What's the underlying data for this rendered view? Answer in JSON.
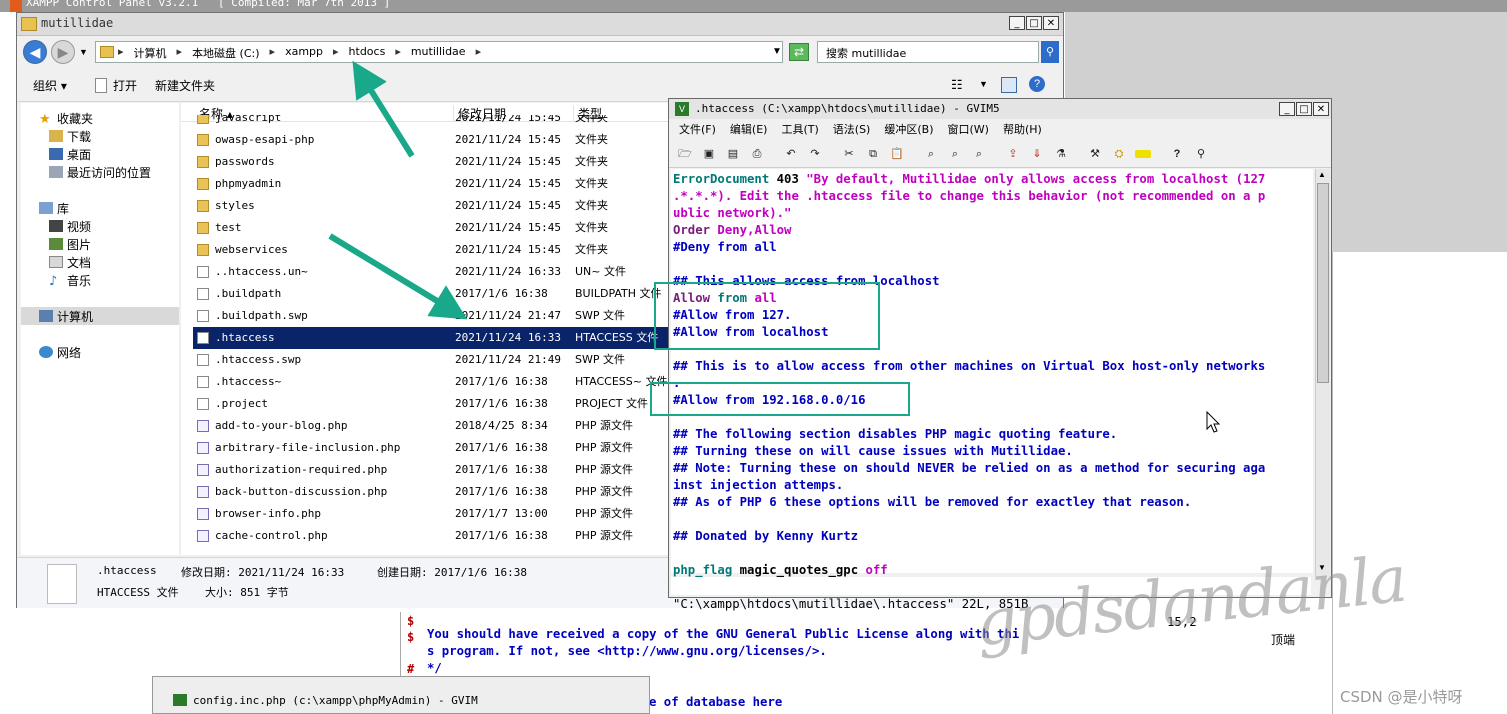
{
  "xampp": {
    "title": "XAMPP Control Panel v3.2.1   [ Compiled: Mar 7th 2013 ]"
  },
  "explorer": {
    "title": "mutillidae",
    "breadcrumbs": [
      "计算机",
      "本地磁盘 (C:)",
      "xampp",
      "htdocs",
      "mutillidae"
    ],
    "search_placeholder": "搜索 mutillidae",
    "toolbar": {
      "organize": "组织",
      "open": "打开",
      "new_folder": "新建文件夹"
    },
    "nav": {
      "favorites": "收藏夹",
      "downloads": "下载",
      "desktop": "桌面",
      "recent": "最近访问的位置",
      "libraries": "库",
      "videos": "视频",
      "pictures": "图片",
      "documents": "文档",
      "music": "音乐",
      "computer": "计算机",
      "network": "网络"
    },
    "columns": {
      "name": "名称",
      "date": "修改日期",
      "type": "类型"
    },
    "files": [
      {
        "name": "javascript",
        "date": "2021/11/24 15:45",
        "type": "文件夹",
        "icon": "folder"
      },
      {
        "name": "owasp-esapi-php",
        "date": "2021/11/24 15:45",
        "type": "文件夹",
        "icon": "folder"
      },
      {
        "name": "passwords",
        "date": "2021/11/24 15:45",
        "type": "文件夹",
        "icon": "folder"
      },
      {
        "name": "phpmyadmin",
        "date": "2021/11/24 15:45",
        "type": "文件夹",
        "icon": "folder"
      },
      {
        "name": "styles",
        "date": "2021/11/24 15:45",
        "type": "文件夹",
        "icon": "folder"
      },
      {
        "name": "test",
        "date": "2021/11/24 15:45",
        "type": "文件夹",
        "icon": "folder"
      },
      {
        "name": "webservices",
        "date": "2021/11/24 15:45",
        "type": "文件夹",
        "icon": "folder"
      },
      {
        "name": "..htaccess.un~",
        "date": "2021/11/24 16:33",
        "type": "UN~ 文件",
        "icon": "file"
      },
      {
        "name": ".buildpath",
        "date": "2017/1/6 16:38",
        "type": "BUILDPATH 文件",
        "icon": "file"
      },
      {
        "name": ".buildpath.swp",
        "date": "2021/11/24 21:47",
        "type": "SWP 文件",
        "icon": "file"
      },
      {
        "name": ".htaccess",
        "date": "2021/11/24 16:33",
        "type": "HTACCESS 文件",
        "icon": "file",
        "selected": true
      },
      {
        "name": ".htaccess.swp",
        "date": "2021/11/24 21:49",
        "type": "SWP 文件",
        "icon": "file"
      },
      {
        "name": ".htaccess~",
        "date": "2017/1/6 16:38",
        "type": "HTACCESS~ 文件",
        "icon": "file"
      },
      {
        "name": ".project",
        "date": "2017/1/6 16:38",
        "type": "PROJECT 文件",
        "icon": "file"
      },
      {
        "name": "add-to-your-blog.php",
        "date": "2018/4/25 8:34",
        "type": "PHP 源文件",
        "icon": "php"
      },
      {
        "name": "arbitrary-file-inclusion.php",
        "date": "2017/1/6 16:38",
        "type": "PHP 源文件",
        "icon": "php"
      },
      {
        "name": "authorization-required.php",
        "date": "2017/1/6 16:38",
        "type": "PHP 源文件",
        "icon": "php"
      },
      {
        "name": "back-button-discussion.php",
        "date": "2017/1/6 16:38",
        "type": "PHP 源文件",
        "icon": "php"
      },
      {
        "name": "browser-info.php",
        "date": "2017/1/7 13:00",
        "type": "PHP 源文件",
        "icon": "php"
      },
      {
        "name": "cache-control.php",
        "date": "2017/1/6 16:38",
        "type": "PHP 源文件",
        "icon": "php"
      }
    ],
    "details": {
      "filename": ".htaccess",
      "filetype": "HTACCESS 文件",
      "modified": "修改日期: 2021/11/24 16:33",
      "created": "创建日期: 2017/1/6 16:38",
      "size": "大小: 851 字节"
    }
  },
  "gvim": {
    "title": ".htaccess (C:\\xampp\\htdocs\\mutillidae) - GVIM5",
    "menu": [
      "文件(F)",
      "编辑(E)",
      "工具(T)",
      "语法(S)",
      "缓冲区(B)",
      "窗口(W)",
      "帮助(H)"
    ],
    "lines": [
      [
        {
          "t": "ErrorDocument ",
          "c": "kw"
        },
        {
          "t": "403 ",
          "c": "blk"
        },
        {
          "t": "\"By default, Mutillidae only allows access from localhost (127",
          "c": "str"
        }
      ],
      [
        {
          "t": ".*.*.*). Edit the .htaccess file to change this behavior (not recommended on a p",
          "c": "str"
        }
      ],
      [
        {
          "t": "ublic network).\"",
          "c": "str"
        }
      ],
      [
        {
          "t": "Order ",
          "c": "pur"
        },
        {
          "t": "Deny,Allow",
          "c": "str"
        }
      ],
      [
        {
          "t": "#Deny from all",
          "c": "cm"
        }
      ],
      [
        {
          "t": "",
          "c": "cm"
        }
      ],
      [
        {
          "t": "## This allows access from localhost",
          "c": "cm"
        }
      ],
      [
        {
          "t": "Allow ",
          "c": "pur"
        },
        {
          "t": "from ",
          "c": "kw"
        },
        {
          "t": "all",
          "c": "str"
        }
      ],
      [
        {
          "t": "#Allow from 127.",
          "c": "cm"
        }
      ],
      [
        {
          "t": "#Allow from localhost",
          "c": "cm"
        }
      ],
      [
        {
          "t": "",
          "c": "cm"
        }
      ],
      [
        {
          "t": "## This is to allow access from other machines on Virtual Box host-only networks",
          "c": "cm"
        }
      ],
      [
        {
          "t": ".",
          "c": "cm"
        }
      ],
      [
        {
          "t": "#Allow from 192.168.0.0/16",
          "c": "cm"
        }
      ],
      [
        {
          "t": "",
          "c": "cm"
        }
      ],
      [
        {
          "t": "## The following section disables PHP magic quoting feature.",
          "c": "cm"
        }
      ],
      [
        {
          "t": "## Turning these on will cause issues with Mutillidae.",
          "c": "cm"
        }
      ],
      [
        {
          "t": "## Note: Turning these on should NEVER be relied on as a method for securing aga",
          "c": "cm"
        }
      ],
      [
        {
          "t": "inst injection attemps.",
          "c": "cm"
        }
      ],
      [
        {
          "t": "## As of PHP 6 these options will be removed for exactley that reason.",
          "c": "cm"
        }
      ],
      [
        {
          "t": "",
          "c": "cm"
        }
      ],
      [
        {
          "t": "## Donated by Kenny Kurtz",
          "c": "cm"
        }
      ],
      [
        {
          "t": "",
          "c": "cm"
        }
      ],
      [
        {
          "t": "php_flag ",
          "c": "kw"
        },
        {
          "t": "magic_quotes_gpc ",
          "c": "blk"
        },
        {
          "t": "off",
          "c": "str"
        }
      ]
    ],
    "status": {
      "file": "\"C:\\xampp\\htdocs\\mutillidae\\.htaccess\" 22L, 851B",
      "pos": "15,2",
      "scroll": "顶端"
    }
  },
  "bottom_vim": {
    "lines": [
      "You should have received a copy of the GNU General Public License along with thi",
      "s program. If not, see <http://www.gnu.org/licenses/>.",
      "*/",
      "",
      "e of database here"
    ],
    "gutter": [
      "$",
      "$",
      "#"
    ]
  },
  "taskbar": {
    "config_title": "config.inc.php (c:\\xampp\\phpMyAdmin) - GVIM"
  },
  "watermark": "gpdsdandanla",
  "csdn": "CSDN @是小特呀",
  "colors": {
    "highlight": "#1aa88a",
    "selection": "#0a246a",
    "comment": "#0000c0"
  }
}
